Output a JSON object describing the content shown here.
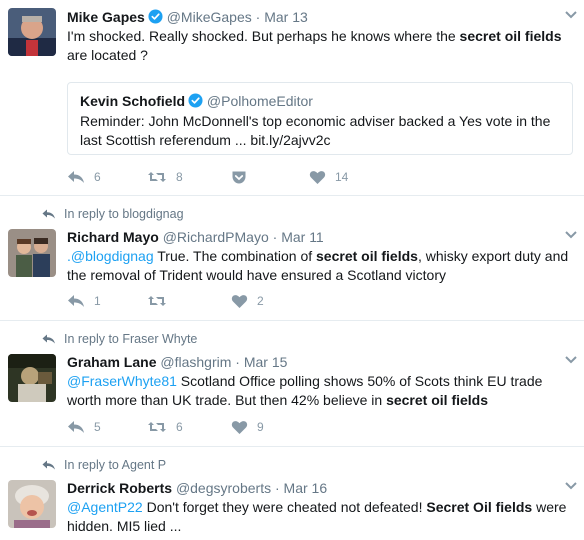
{
  "tweets": [
    {
      "name": "Mike Gapes",
      "handle": "@MikeGapes",
      "separator": "·",
      "time": "Mar 13",
      "verified": true,
      "text_parts": [
        "I'm shocked.  Really shocked.  But perhaps he knows where the ",
        "secret oil fields",
        " are located ?"
      ],
      "quote": {
        "name": "Kevin Schofield",
        "handle": "@PolhomeEditor",
        "verified": true,
        "text": "Reminder: John McDonnell's top economic adviser backed a Yes vote in the last Scottish referendum ... bit.ly/2ajvv2c"
      },
      "replies": "6",
      "retweets": "8",
      "likes": "14"
    },
    {
      "reply_context": "In reply to blogdignag",
      "name": "Richard Mayo",
      "handle": "@RichardPMayo",
      "separator": "·",
      "time": "Mar 11",
      "text_parts": [
        ".@blogdignag",
        " True. The combination of ",
        "secret oil fields",
        ", whisky export duty and the removal of Trident would have ensured a Scotland victory"
      ],
      "replies": "1",
      "retweets": "",
      "likes": "2"
    },
    {
      "reply_context": "In reply to Fraser Whyte",
      "name": "Graham Lane",
      "handle": "@flashgrim",
      "separator": "·",
      "time": "Mar 15",
      "text_parts": [
        "@FraserWhyte81",
        " Scotland Office polling shows 50% of Scots think EU trade worth more than UK trade. But then 42% believe in ",
        "secret oil fields"
      ],
      "replies": "5",
      "retweets": "6",
      "likes": "9"
    },
    {
      "reply_context": "In reply to Agent P",
      "name": "Derrick Roberts",
      "handle": "@degsyroberts",
      "separator": "·",
      "time": "Mar 16",
      "text_parts": [
        "@AgentP22",
        " Don't forget they were cheated not defeated! ",
        "Secret Oil fields",
        " were hidden. MI5 lied ..."
      ]
    }
  ],
  "colors": {
    "link": "#1da1f2",
    "muted": "#657786",
    "action": "#8899a6",
    "border": "#e6ecf0",
    "verified": "#1da1f2"
  },
  "icons": [
    "reply-icon",
    "retweet-icon",
    "pocket-icon",
    "heart-icon",
    "verified-badge-icon",
    "caret-down-icon",
    "reply-context-arrow-icon"
  ]
}
